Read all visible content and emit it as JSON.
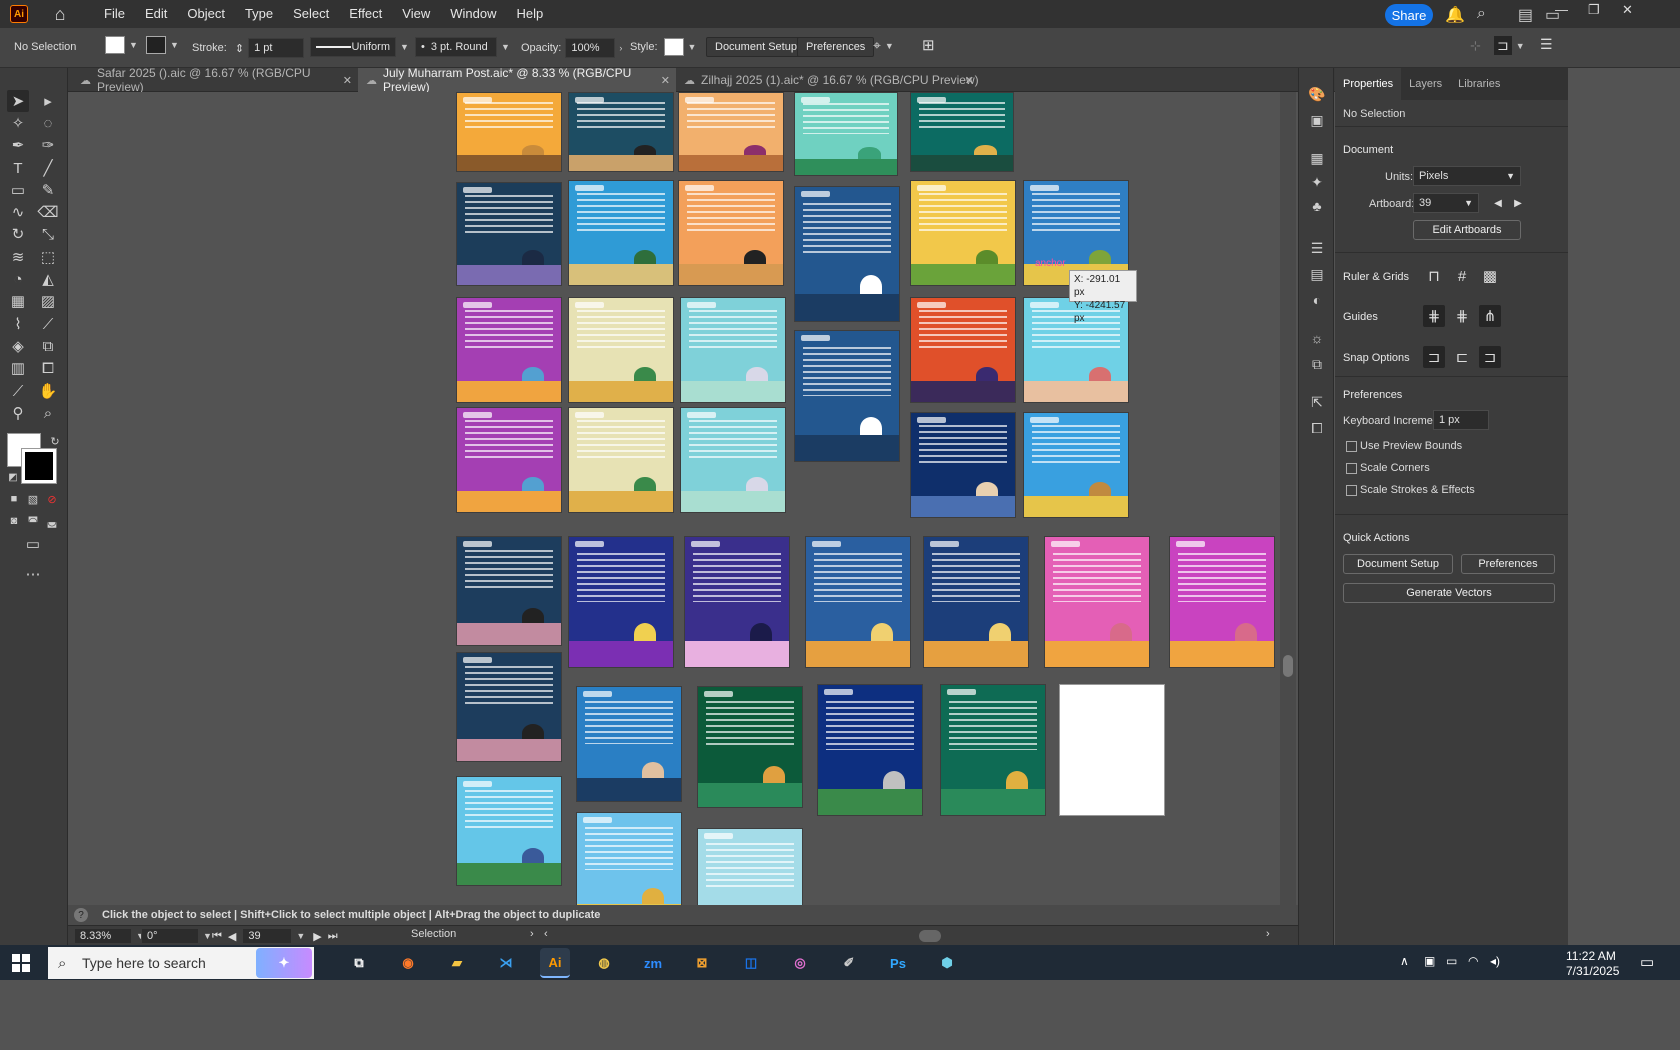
{
  "app": {
    "logo_text": "Ai",
    "menu": [
      "File",
      "Edit",
      "Object",
      "Type",
      "Select",
      "Effect",
      "View",
      "Window",
      "Help"
    ],
    "share_label": "Share"
  },
  "control": {
    "selection": "No Selection",
    "stroke_label": "Stroke:",
    "stroke_value": "1 pt",
    "profile": "Uniform",
    "brush": "3 pt. Round",
    "opacity_label": "Opacity:",
    "opacity_value": "100%",
    "style_label": "Style:",
    "doc_setup": "Document Setup",
    "preferences": "Preferences"
  },
  "tabs": [
    {
      "label": "Safar 2025 ().aic @ 16.67 % (RGB/CPU Preview)"
    },
    {
      "label": "July Muharram Post.aic* @ 8.33 % (RGB/CPU Preview)"
    },
    {
      "label": "Zilhajj 2025 (1).aic* @ 16.67 % (RGB/CPU Preview)"
    }
  ],
  "canvas": {
    "tooltip_x": "X: -291.01 px",
    "tooltip_y": "Y: -4241.57 px",
    "anchor_label": "anchor",
    "artboards": [
      {
        "bg": "#f4a93a",
        "ground": "#8a5a2a",
        "dome": "#c98b3a"
      },
      {
        "bg": "#1d4d63",
        "ground": "#c9a16a",
        "dome": "#222"
      },
      {
        "bg": "#f2b06d",
        "ground": "#b96f3a",
        "dome": "#8c2f6b"
      },
      {
        "bg": "#6fd1c1",
        "ground": "#2f8f5b",
        "dome": "#3aa37a"
      },
      {
        "bg": "#0c6b62",
        "ground": "#1a4d3f",
        "dome": "#e0b14a"
      },
      {
        "bg": "#1c3d5a",
        "ground": "#7a6bb1",
        "dome": "#1b2a44"
      },
      {
        "bg": "#2f9bd6",
        "ground": "#d8c07a",
        "dome": "#2e6e3b"
      },
      {
        "bg": "#f3a05a",
        "ground": "#d89a52",
        "dome": "#222"
      },
      {
        "bg": "#23578f",
        "ground": "#1b3c63",
        "dome": "#ffffff"
      },
      {
        "bg": "#f2c84a",
        "ground": "#6aa33a",
        "dome": "#5b8c2a"
      },
      {
        "bg": "#2f7fc4",
        "ground": "#e6c54a",
        "dome": "#7ea43a"
      },
      {
        "bg": "#a43fb3",
        "ground": "#f0a440",
        "dome": "#53a0d1"
      },
      {
        "bg": "#e7e2b4",
        "ground": "#e0b04a",
        "dome": "#3a8a4a"
      },
      {
        "bg": "#7fd1d9",
        "ground": "#a9ded1",
        "dome": "#d8d8e8"
      },
      {
        "bg": "#23578f",
        "ground": "#1b3c63",
        "dome": "#ffffff"
      },
      {
        "bg": "#e0502a",
        "ground": "#3b2a5a",
        "dome": "#3a2a70"
      },
      {
        "bg": "#6fd1e6",
        "ground": "#e8c0a0",
        "dome": "#d87070"
      },
      {
        "bg": "#a43fb3",
        "ground": "#f0a440",
        "dome": "#53a0d1"
      },
      {
        "bg": "#e7e2b4",
        "ground": "#e0b04a",
        "dome": "#3a8a4a"
      },
      {
        "bg": "#7fd1d9",
        "ground": "#a9ded1",
        "dome": "#d8d8e8"
      },
      {
        "bg": "#0f2f6b",
        "ground": "#4a6fb1",
        "dome": "#e8d0b0"
      },
      {
        "bg": "#39a0e0",
        "ground": "#e6c54a",
        "dome": "#c08a40"
      },
      {
        "bg": "#1d3d5d",
        "ground": "#c28ba0",
        "dome": "#222"
      },
      {
        "bg": "#23308c",
        "ground": "#7b2fb3",
        "dome": "#f0d050"
      },
      {
        "bg": "#3a2f8c",
        "ground": "#e8b0e0",
        "dome": "#1b1b4a"
      },
      {
        "bg": "#2a5fa0",
        "ground": "#e6a040",
        "dome": "#f0d070"
      },
      {
        "bg": "#1c3e7a",
        "ground": "#e6a040",
        "dome": "#f0d070"
      },
      {
        "bg": "#e45fb6",
        "ground": "#f0a440",
        "dome": "#d86a8a"
      },
      {
        "bg": "#c943c0",
        "ground": "#f0a440",
        "dome": "#d86a8a"
      },
      {
        "bg": "#1d3d5d",
        "ground": "#c28ba0",
        "dome": "#222"
      },
      {
        "bg": "#2a7fc4",
        "ground": "#1b3c63",
        "dome": "#e0c0a0"
      },
      {
        "bg": "#0c5a3a",
        "ground": "#2a8a5a",
        "dome": "#e0a040"
      },
      {
        "bg": "#0d2f80",
        "ground": "#3a8a4a",
        "dome": "#c0c0c0"
      },
      {
        "bg": "#0e6b54",
        "ground": "#2a8a5a",
        "dome": "#e0b040"
      },
      {
        "bg": "#ffffff",
        "ground": "#ffffff",
        "dome": "#ffffff"
      },
      {
        "bg": "#64c6e8",
        "ground": "#3a8a4a",
        "dome": "#3a5a9a"
      },
      {
        "bg": "#6ec3ec",
        "ground": "#e6c54a",
        "dome": "#e0b040"
      },
      {
        "bg": "#a4dce8",
        "ground": "#e6c54a",
        "dome": "#d0a060"
      }
    ]
  },
  "panel": {
    "tabs": [
      "Properties",
      "Layers",
      "Libraries"
    ],
    "no_selection": "No Selection",
    "document": "Document",
    "units_label": "Units:",
    "units_value": "Pixels",
    "artboard_label": "Artboard:",
    "artboard_value": "39",
    "edit_artboards": "Edit Artboards",
    "ruler_grids": "Ruler & Grids",
    "guides": "Guides",
    "snap_options": "Snap Options",
    "preferences_h": "Preferences",
    "keyboard_inc_label": "Keyboard Increment:",
    "keyboard_inc_value": "1 px",
    "use_preview_bounds": "Use Preview Bounds",
    "scale_corners": "Scale Corners",
    "scale_strokes": "Scale Strokes & Effects",
    "quick_actions": "Quick Actions",
    "doc_setup_btn": "Document Setup",
    "preferences_btn": "Preferences",
    "generate_vectors": "Generate Vectors"
  },
  "status": {
    "hint": "Click the object to select  |  Shift+Click to select multiple object  |  Alt+Drag the object to duplicate",
    "zoom": "8.33%",
    "angle": "0°",
    "artboard": "39",
    "tool": "Selection"
  },
  "taskbar": {
    "search_placeholder": "Type here to search",
    "time": "11:22 AM",
    "date": "7/31/2025"
  }
}
